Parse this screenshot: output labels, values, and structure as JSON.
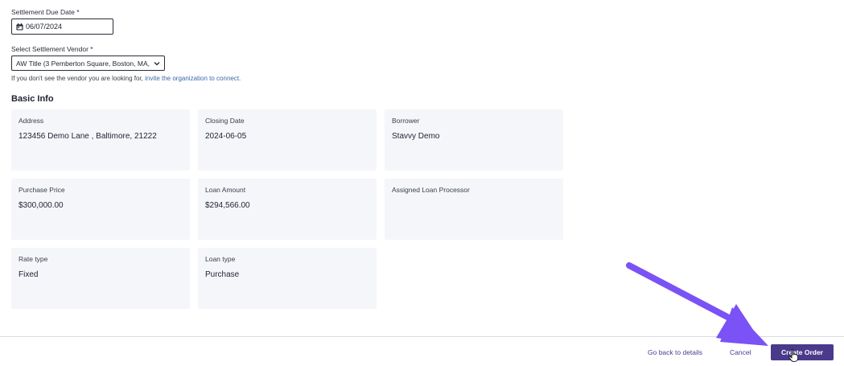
{
  "form": {
    "settlement_due_date_label": "Settlement Due Date",
    "settlement_due_date_value": "06/07/2024",
    "vendor_label": "Select Settlement Vendor",
    "required_mark": "*",
    "vendor_selected": "AW Title (3 Pemberton Square, Boston, MA,",
    "help_text_prefix": "If you don't see the vendor you are looking for,",
    "help_link": "invite the organization to connect."
  },
  "basic_info": {
    "title": "Basic Info",
    "cards": [
      {
        "label": "Address",
        "value": "123456 Demo Lane , Baltimore, 21222"
      },
      {
        "label": "Closing Date",
        "value": "2024-06-05"
      },
      {
        "label": "Borrower",
        "value": "Stavvy Demo"
      },
      {
        "label": "Purchase Price",
        "value": "$300,000.00"
      },
      {
        "label": "Loan Amount",
        "value": "$294,566.00"
      },
      {
        "label": "Assigned Loan Processor",
        "value": ""
      },
      {
        "label": "Rate type",
        "value": "Fixed"
      },
      {
        "label": "Loan type",
        "value": "Purchase"
      }
    ]
  },
  "footer": {
    "back_label": "Go back to details",
    "cancel_label": "Cancel",
    "create_label": "Create Order"
  },
  "colors": {
    "primary": "#4a3a8c",
    "annotation_arrow": "#7b52f5",
    "card_bg": "#f5f6fa",
    "link": "#3b6aa8"
  },
  "icons": {
    "date": "calendar-icon",
    "select": "chevron-down-icon",
    "pointer": "hand-cursor-icon",
    "annotation": "arrow-annotation-icon"
  }
}
